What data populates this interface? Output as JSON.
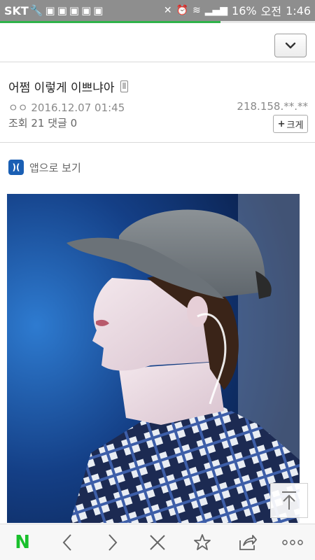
{
  "status_bar": {
    "carrier": "SKT",
    "battery": "16%",
    "ampm": "오전",
    "time": "1:46",
    "notification_icons": [
      "wrench-icon",
      "notification-icon",
      "notification-icon",
      "notification-icon",
      "notification-icon",
      "notification-icon"
    ]
  },
  "page_load_progress": 0.7,
  "post": {
    "title": "어쩜 이렇게 이쁘냐아",
    "author_date": "ㅇㅇ 2016.12.07 01:45",
    "ip": "218.158.**.**",
    "stats": "조회 21  댓글 0",
    "enlarge_label": "크게",
    "enlarge_plus": "+"
  },
  "app_link": {
    "label": "앱으로 보기",
    "icon_text": ")("
  },
  "colors": {
    "status_bar_bg": "#8e8e8e",
    "progress": "#2fb34a",
    "naver_green": "#19c02c"
  },
  "bottom_nav": {
    "logo": "N",
    "icons": [
      "naver-logo",
      "back-icon",
      "forward-icon",
      "close-icon",
      "star-icon",
      "share-icon",
      "more-icon"
    ]
  }
}
